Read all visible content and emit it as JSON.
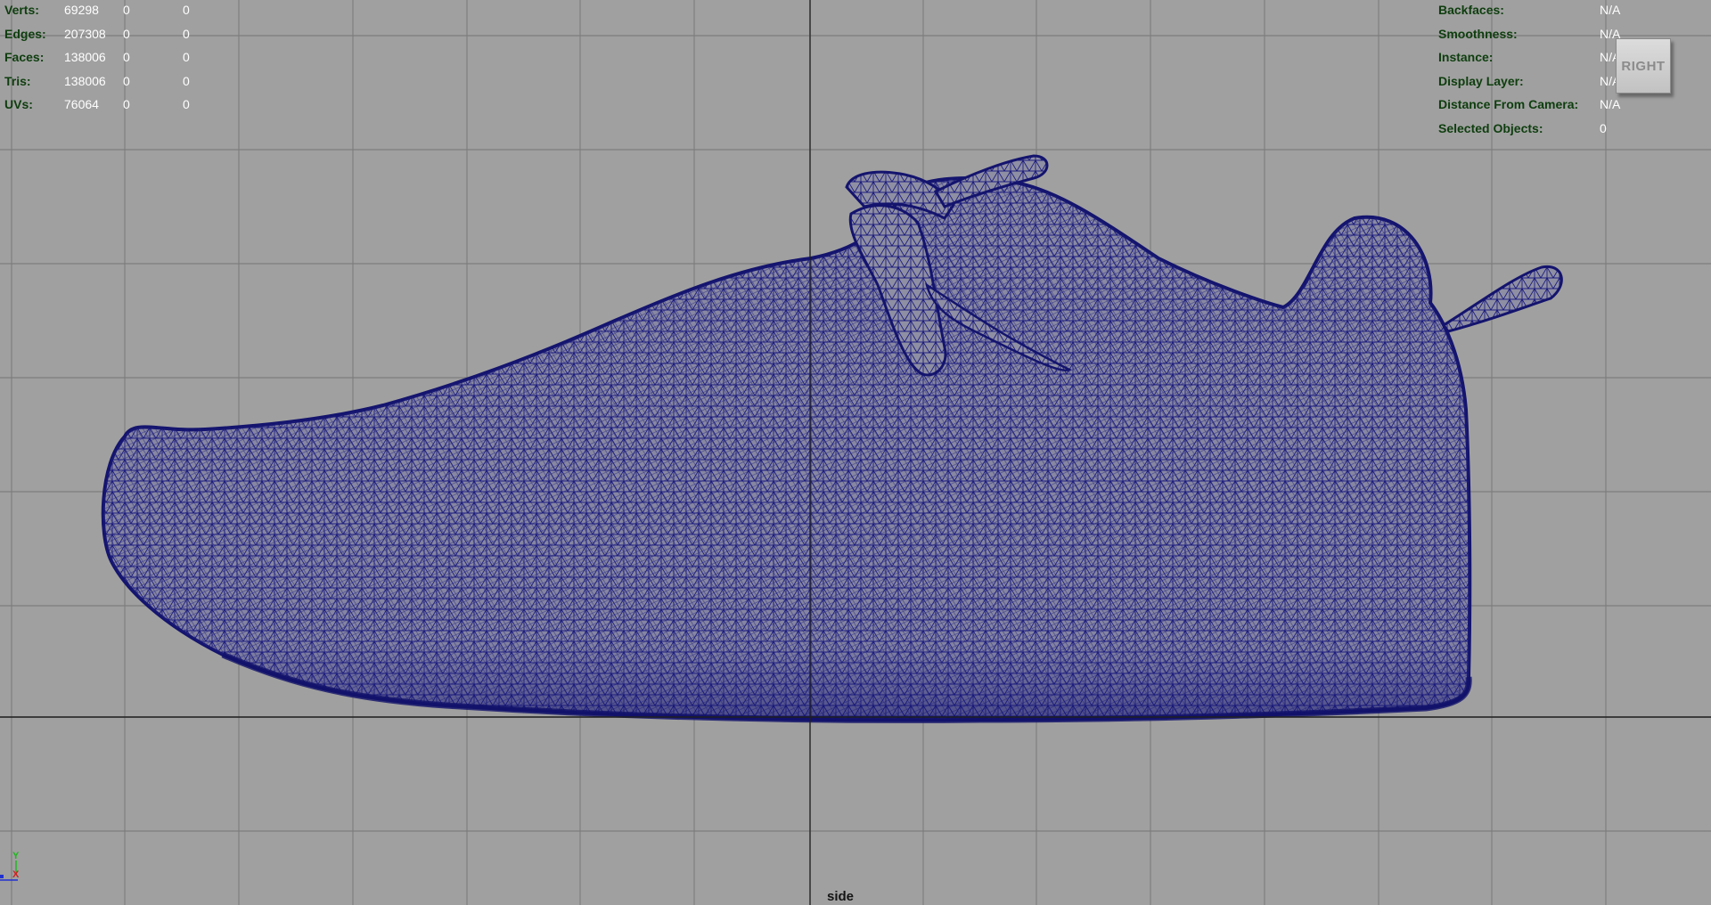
{
  "hud_left": [
    {
      "label": "Verts:",
      "v1": "69298",
      "v2": "0",
      "v3": "0"
    },
    {
      "label": "Edges:",
      "v1": "207308",
      "v2": "0",
      "v3": "0"
    },
    {
      "label": "Faces:",
      "v1": "138006",
      "v2": "0",
      "v3": "0"
    },
    {
      "label": "Tris:",
      "v1": "138006",
      "v2": "0",
      "v3": "0"
    },
    {
      "label": "UVs:",
      "v1": "76064",
      "v2": "0",
      "v3": "0"
    }
  ],
  "hud_right": [
    {
      "label": "Backfaces:",
      "value": "N/A"
    },
    {
      "label": "Smoothness:",
      "value": "N/A"
    },
    {
      "label": "Instance:",
      "value": "N/A"
    },
    {
      "label": "Display Layer:",
      "value": "N/A"
    },
    {
      "label": "Distance From Camera:",
      "value": "N/A"
    },
    {
      "label": "Selected Objects:",
      "value": "0"
    }
  ],
  "view_cube_label": "RIGHT",
  "camera_name": "side",
  "axis_gizmo": {
    "y_label": "Y",
    "x_label": "X"
  },
  "colors": {
    "viewport_bg": "#a0a0a0",
    "grid_line": "#7e7e7e",
    "grid_axis": "#2a2a2a",
    "wireframe": "#1a1a7a",
    "hud_label": "#0e3d0e",
    "hud_value": "#ffffff"
  },
  "scene": {
    "object": "shoe-wireframe-mesh"
  }
}
